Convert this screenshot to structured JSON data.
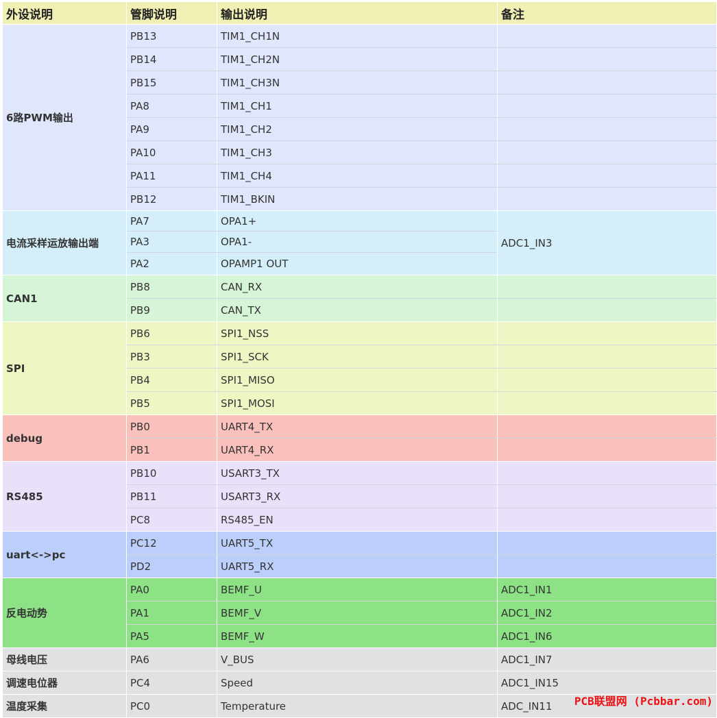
{
  "headers": [
    "外设说明",
    "管脚说明",
    "输出说明",
    "备注"
  ],
  "groups": [
    {
      "name": "6路PWM输出",
      "color": "#e0e6fc",
      "shared_note": "",
      "rows": [
        {
          "pin": "PB13",
          "out": "TIM1_CH1N",
          "note": ""
        },
        {
          "pin": "PB14",
          "out": "TIM1_CH2N",
          "note": ""
        },
        {
          "pin": "PB15",
          "out": "TIM1_CH3N",
          "note": ""
        },
        {
          "pin": "PA8",
          "out": "TIM1_CH1",
          "note": ""
        },
        {
          "pin": "PA9",
          "out": "TIM1_CH2",
          "note": ""
        },
        {
          "pin": "PA10",
          "out": "TIM1_CH3",
          "note": ""
        },
        {
          "pin": "PA11",
          "out": "TIM1_CH4",
          "note": ""
        },
        {
          "pin": "PB12",
          "out": "TIM1_BKIN",
          "note": ""
        }
      ]
    },
    {
      "name": "电流采样运放输出端",
      "color": "#d5effa",
      "shared_note": "ADC1_IN3",
      "rows": [
        {
          "pin": "PA7",
          "out": "OPA1+",
          "note": ""
        },
        {
          "pin": "PA3",
          "out": "OPA1-",
          "note": ""
        },
        {
          "pin": "PA2",
          "out": " OPAMP1 OUT",
          "note": ""
        }
      ]
    },
    {
      "name": "CAN1",
      "color": "#d6f4d6",
      "shared_note": "",
      "rows": [
        {
          "pin": "PB8",
          "out": "CAN_RX",
          "note": ""
        },
        {
          "pin": "PB9",
          "out": "CAN_TX",
          "note": ""
        }
      ]
    },
    {
      "name": "SPI",
      "color": "#eef6c4",
      "shared_note": "",
      "rows": [
        {
          "pin": "PB6",
          "out": "SPI1_NSS",
          "note": ""
        },
        {
          "pin": "PB3",
          "out": "SPI1_SCK",
          "note": ""
        },
        {
          "pin": "PB4",
          "out": "SPI1_MISO",
          "note": ""
        },
        {
          "pin": "PB5",
          "out": "SPI1_MOSI",
          "note": ""
        }
      ]
    },
    {
      "name": "debug",
      "color": "#fac0bc",
      "shared_note": "",
      "rows": [
        {
          "pin": "PB0",
          "out": "UART4_TX",
          "note": ""
        },
        {
          "pin": "PB1",
          "out": "UART4_RX",
          "note": ""
        }
      ]
    },
    {
      "name": "RS485",
      "color": "#ebe0fa",
      "shared_note": "",
      "rows": [
        {
          "pin": "PB10",
          "out": "USART3_TX",
          "note": ""
        },
        {
          "pin": "PB11",
          "out": "USART3_RX",
          "note": ""
        },
        {
          "pin": "PC8",
          "out": "RS485_EN",
          "note": ""
        }
      ]
    },
    {
      "name": "uart<->pc",
      "color": "#bccefa",
      "shared_note": "",
      "rows": [
        {
          "pin": "PC12",
          "out": "UART5_TX",
          "note": ""
        },
        {
          "pin": "PD2",
          "out": "UART5_RX",
          "note": ""
        }
      ]
    },
    {
      "name": "反电动势",
      "color": "#8ee286",
      "shared_note": "",
      "rows": [
        {
          "pin": "PA0",
          "out": "BEMF_U",
          "note": "ADC1_IN1"
        },
        {
          "pin": "PA1",
          "out": "BEMF_V",
          "note": "ADC1_IN2"
        },
        {
          "pin": "PA5",
          "out": "BEMF_W",
          "note": "ADC1_IN6"
        }
      ]
    },
    {
      "name": "母线电压",
      "color": "#e0e1e3",
      "shared_note": "",
      "rows": [
        {
          "pin": "PA6",
          "out": "V_BUS",
          "note": "ADC1_IN7"
        }
      ]
    },
    {
      "name": "调速电位器",
      "color": "#e0e1e3",
      "shared_note": "",
      "rows": [
        {
          "pin": "PC4",
          "out": "Speed",
          "note": "ADC1_IN15"
        }
      ]
    },
    {
      "name": "温度采集",
      "color": "#e0e1e3",
      "shared_note": "",
      "rows": [
        {
          "pin": "PC0",
          "out": "Temperature",
          "note": "ADC_IN11"
        }
      ]
    }
  ],
  "watermark": "PCB联盟网 (Pcbbar.com)"
}
